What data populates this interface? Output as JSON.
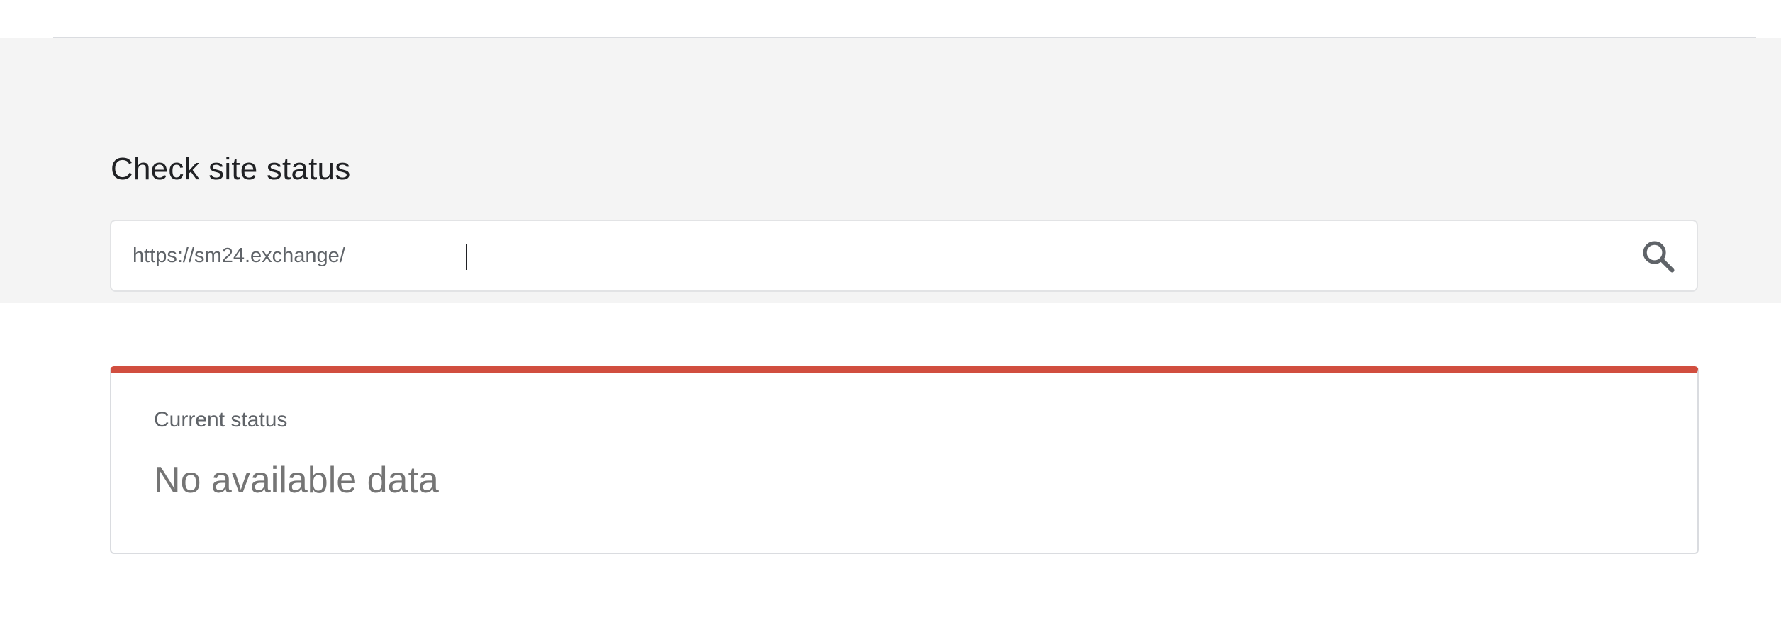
{
  "search": {
    "title": "Check site status",
    "value": "https://sm24.exchange/",
    "button_icon": "search-icon"
  },
  "status": {
    "label": "Current status",
    "value": "No available data",
    "accent_color": "#d14e3f"
  }
}
